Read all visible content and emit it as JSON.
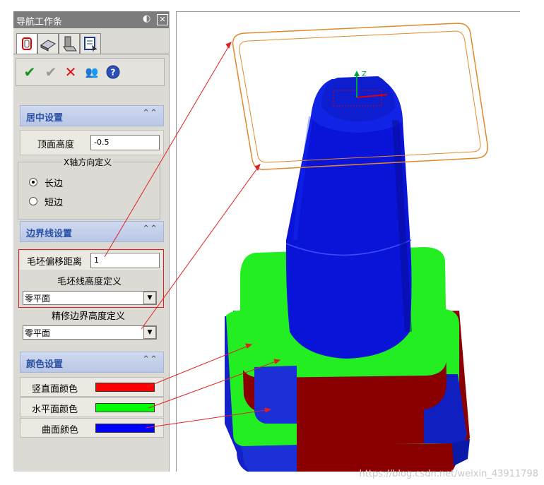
{
  "panel": {
    "title": "导航工作条",
    "tabs": [
      "outline-tab",
      "surface-tab",
      "tool-tab",
      "report-tab"
    ],
    "toolbar": {
      "ok": "✔",
      "apply": "✔",
      "cancel": "✕",
      "people": "👥",
      "help": "?"
    },
    "centering": {
      "title": "居中设置",
      "top_height_label": "顶面高度",
      "top_height_value": "-0.5",
      "x_axis_group": "X轴方向定义",
      "long_side": "长边",
      "short_side": "短边"
    },
    "boundary": {
      "title": "边界线设置",
      "offset_label": "毛坯偏移距离",
      "offset_value": "1",
      "blank_height_label": "毛坯线高度定义",
      "blank_height_value": "零平面",
      "finish_height_label": "精修边界高度定义",
      "finish_height_value": "零平面"
    },
    "color": {
      "title": "颜色设置",
      "vertical_label": "竖直面颜色",
      "horizontal_label": "水平面颜色",
      "curved_label": "曲面颜色",
      "vertical_color": "#ff0000",
      "horizontal_color": "#00ff00",
      "curved_color": "#0000ff"
    }
  },
  "viewport": {
    "axis_label": "Z",
    "watermark": "https://blog.csdn.net/weixin_43911798"
  }
}
